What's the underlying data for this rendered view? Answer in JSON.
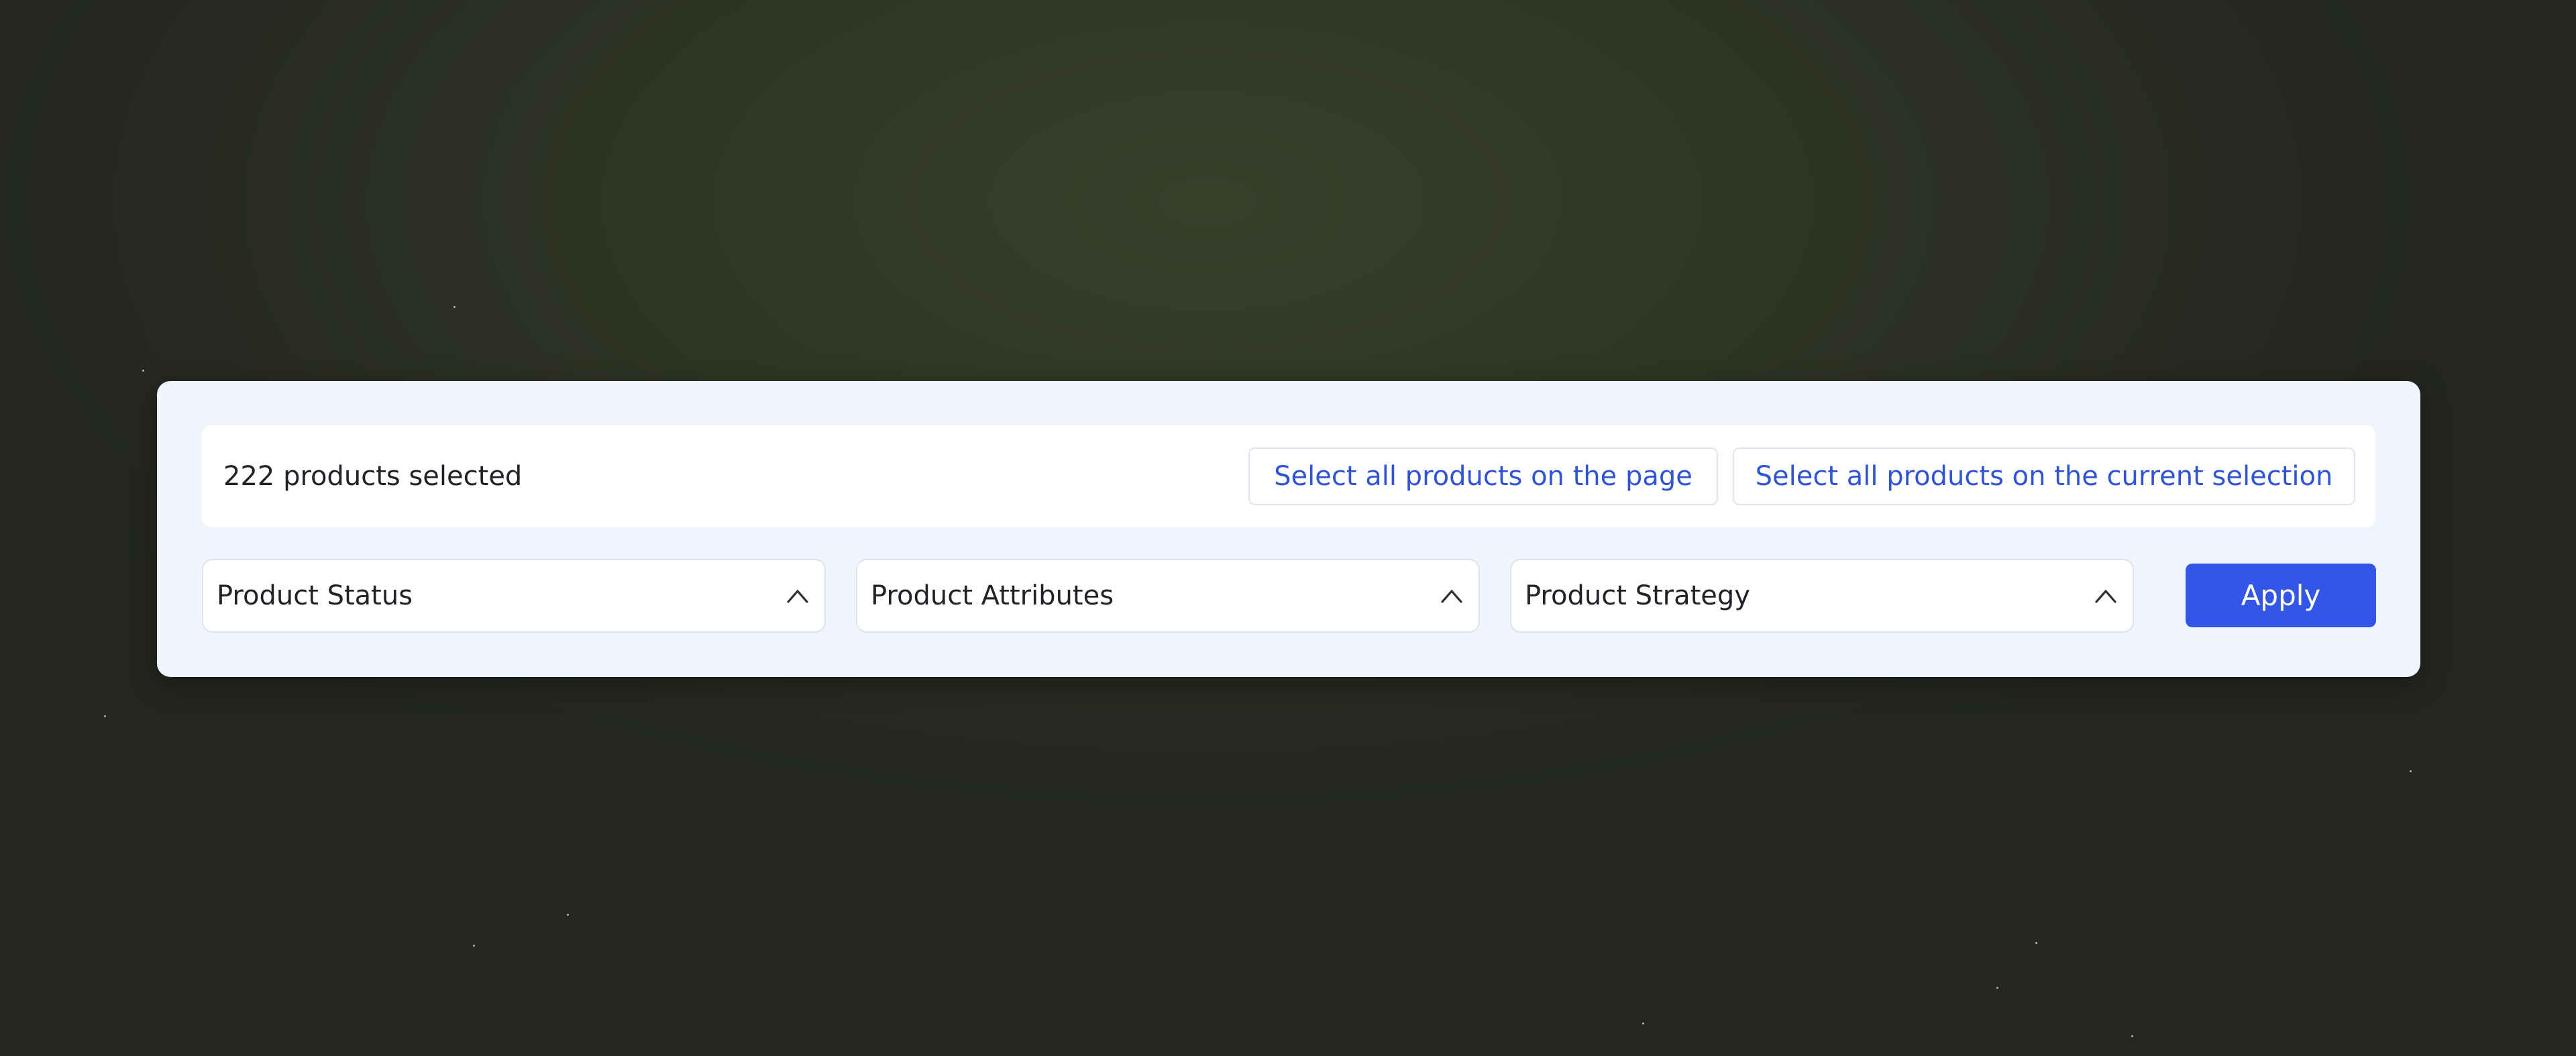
{
  "selection": {
    "count_text": "222 products selected",
    "select_page_label": "Select all products on the page",
    "select_current_label": "Select all products on the current selection"
  },
  "filters": {
    "status": {
      "label": "Product Status",
      "icon": "chevron-up-icon"
    },
    "attributes": {
      "label": "Product Attributes",
      "icon": "chevron-up-icon"
    },
    "strategy": {
      "label": "Product Strategy",
      "icon": "chevron-up-icon"
    }
  },
  "actions": {
    "apply_label": "Apply"
  },
  "colors": {
    "accent": "#3356e6",
    "link": "#2f54d6",
    "panel_background": "#eff4fd",
    "page_background": "#2c3124"
  }
}
